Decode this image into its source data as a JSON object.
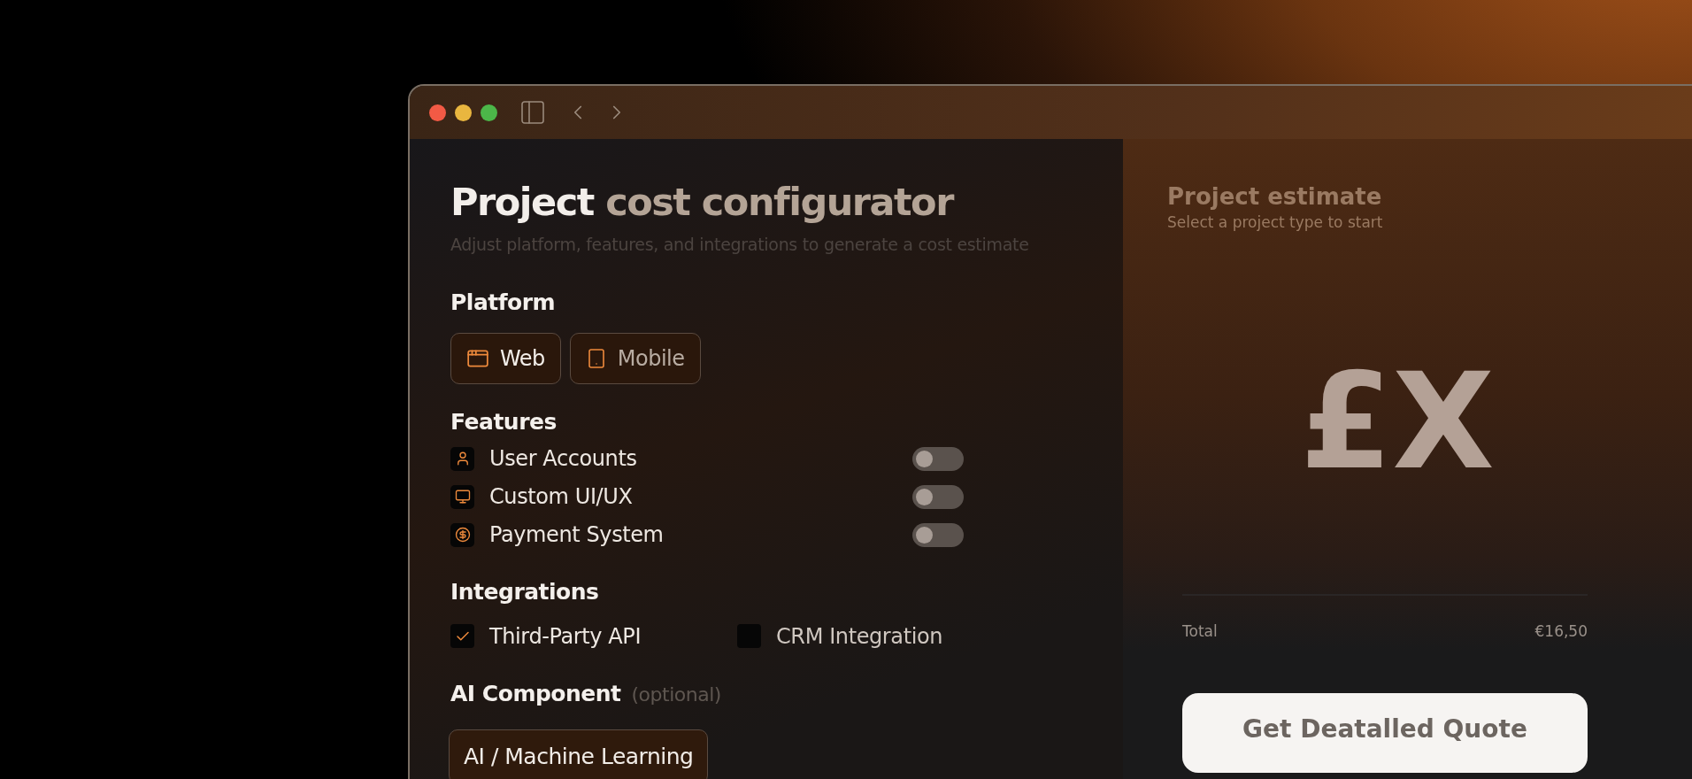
{
  "header": {
    "title_lead": "Project",
    "title_rest": "cost configurator",
    "subtitle": "Adjust platform, features, and integrations to generate a cost estimate"
  },
  "platform": {
    "heading": "Platform",
    "options": [
      {
        "kind": "web",
        "label": "Web",
        "selected": true
      },
      {
        "kind": "mobile",
        "label": "Mobile",
        "selected": false
      }
    ]
  },
  "features": {
    "heading": "Features",
    "items": [
      {
        "kind": "user",
        "label": "User Accounts",
        "on": false
      },
      {
        "kind": "monitor",
        "label": "Custom UI/UX",
        "on": false
      },
      {
        "kind": "payment",
        "label": "Payment System",
        "on": false
      }
    ]
  },
  "integrations": {
    "heading": "Integrations",
    "items": [
      {
        "label": "Third-Party API",
        "checked": true
      },
      {
        "label": "CRM Integration",
        "checked": false
      }
    ]
  },
  "ai_component": {
    "heading": "AI Component",
    "note": "(optional)",
    "option": "AI / Machine Learning"
  },
  "estimate": {
    "title": "Project estimate",
    "subtitle": "Select a project type to start",
    "amount": "£X",
    "total_label": "Total",
    "total_value": "€16,50",
    "button": "Get Deatalled Quote"
  }
}
